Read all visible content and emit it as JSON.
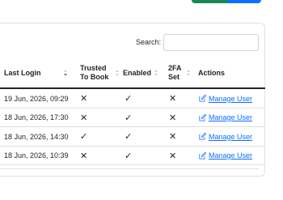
{
  "search": {
    "label": "Search:",
    "value": "",
    "placeholder": ""
  },
  "table": {
    "headers": {
      "last_login": "Last Login",
      "trusted_line1": "Trusted",
      "trusted_line2": "To Book",
      "enabled": "Enabled",
      "twofa_line1": "2FA",
      "twofa_line2": "Set",
      "actions": "Actions"
    },
    "sorted_column": "Last Login",
    "sort_direction": "descending",
    "rows": [
      {
        "last_login": "19 Jun, 2026, 09:29",
        "trusted": "✕",
        "enabled": "✓",
        "twofa": "✕",
        "action": "Manage User"
      },
      {
        "last_login": "18 Jun, 2026, 17:30",
        "trusted": "✕",
        "enabled": "✓",
        "twofa": "✕",
        "action": "Manage User"
      },
      {
        "last_login": "18 Jun, 2026, 14:30",
        "trusted": "✓",
        "enabled": "✓",
        "twofa": "✕",
        "action": "Manage User"
      },
      {
        "last_login": "18 Jun, 2026, 10:39",
        "trusted": "✕",
        "enabled": "✓",
        "twofa": "✕",
        "action": "Manage User"
      }
    ]
  },
  "colors": {
    "link": "#0d6efd",
    "primary_button": "#0d6efd",
    "success_button": "#198754",
    "border": "#dee2e6"
  },
  "icons": {
    "action_icon": "edit-square-icon"
  }
}
